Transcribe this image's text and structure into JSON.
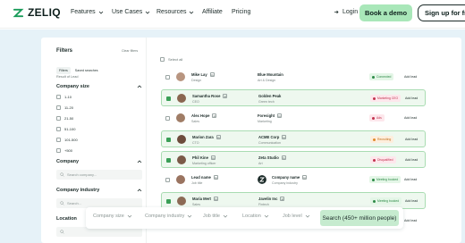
{
  "nav": {
    "logo": "ZELIQ",
    "items": [
      "Features",
      "Use Cases",
      "Resources",
      "Affiliate",
      "Pricing"
    ],
    "login": "Login",
    "demo": "Book a demo",
    "signup": "Sign up for free"
  },
  "filters": {
    "title": "Filters",
    "clear": "Clear filters",
    "tabs": [
      "Filters",
      "Saved searches"
    ],
    "caption": "Result of Lead",
    "company_size": {
      "title": "Company size",
      "options": [
        "1-10",
        "11-20",
        "21-50",
        "51-100",
        "101-500",
        "+500"
      ]
    },
    "company": {
      "title": "Company",
      "placeholder": "Search company..."
    },
    "industry": {
      "title": "Company industry",
      "placeholder": "Search..."
    },
    "location": {
      "title": "Location"
    }
  },
  "table": {
    "select_all": "Select all",
    "rows": [
      {
        "name": "Mike Lay",
        "role": "Design",
        "company": "Blue Mountain",
        "industry": "Art & Design",
        "status": "Connected",
        "action": "Add lead",
        "selected": false
      },
      {
        "name": "Samantha Rose",
        "role": "CEO",
        "company": "Golden Peak",
        "industry": "Green tech",
        "status": "Marketing CEO",
        "action": "Add lead",
        "selected": true
      },
      {
        "name": "Alex Hope",
        "role": "Sales",
        "company": "Foresight",
        "industry": "Marketing",
        "status": "Ads",
        "action": "Add lead",
        "selected": false
      },
      {
        "name": "Marion Zara",
        "role": "CTO",
        "company": "ACME Corp",
        "industry": "Communication",
        "status": "Recruiting",
        "action": "Add lead",
        "selected": true
      },
      {
        "name": "Phil Kine",
        "role": "Marketing officer",
        "company": "Zeta Studio",
        "industry": "Art",
        "status": "Disqualified",
        "action": "Add lead",
        "selected": true
      },
      {
        "name": "Lead name",
        "role": "Job title",
        "company": "Company name",
        "industry": "Company industry",
        "status": "Meeting booked",
        "action": "Add lead",
        "selected": false
      },
      {
        "name": "Maria Mert",
        "role": "Sales",
        "company": "Javelin Inc",
        "industry": "Fintech",
        "status": "Meeting booked",
        "action": "Add lead",
        "selected": true
      },
      {
        "name": "Lead name",
        "role": "Job title",
        "company": "Company name",
        "industry": "Company industry",
        "status": "Meeting booked",
        "action": "Add lead",
        "selected": false
      }
    ]
  },
  "searchbar": {
    "fields": [
      "Company size",
      "Company industry",
      "Job title",
      "Location",
      "Job level"
    ],
    "button": "Search (450+ million people)"
  },
  "colors": {
    "accent": "#a9e7b9",
    "selected_row": "#eef8ef",
    "stage_bg": "#e6f2f8"
  }
}
